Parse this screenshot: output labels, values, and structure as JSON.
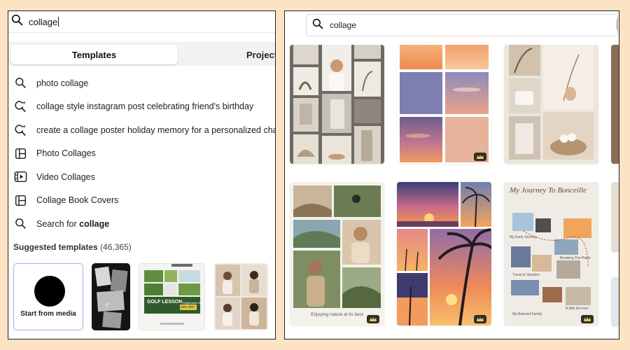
{
  "left": {
    "search_value": "collage",
    "tabs": {
      "active": "Templates",
      "other": "Projects"
    },
    "items": [
      {
        "icon": "search-icon",
        "label": "photo collage"
      },
      {
        "icon": "magic-search-icon",
        "label": "collage style instagram post celebrating friend's birthday"
      },
      {
        "icon": "magic-search-icon",
        "label": "create a collage poster holiday memory for a personalized chat"
      },
      {
        "icon": "photo-grid-icon",
        "label": "Photo Collages"
      },
      {
        "icon": "video-grid-icon",
        "label": "Video Collages"
      },
      {
        "icon": "book-grid-icon",
        "label": "Collage Book Covers"
      }
    ],
    "search_for": {
      "prefix": "Search for ",
      "term": "collage"
    },
    "suggested": {
      "label": "Suggested templates",
      "count": "(46,365)"
    },
    "start_media": "Start from media",
    "thumb_texts": {
      "golf_title": "GOLF LESSON",
      "golf_sub": "Registration Now",
      "golf_badge": "10% OFF"
    }
  },
  "right": {
    "search_value": "collage",
    "card_texts": {
      "nature": "Enjoying nature at its best",
      "journey_title": "My Journey To Bonceille",
      "labels": [
        "My Early Journey",
        "Breaking The Plane",
        "Travel & Vacation",
        "My Beloved Family",
        "A little bit more"
      ]
    }
  },
  "colors": {
    "background": "#fbe3c4",
    "accent_border": "#b6a7e8",
    "sunset_orange": "#f08a45",
    "sunset_purple": "#6b5a8c"
  }
}
